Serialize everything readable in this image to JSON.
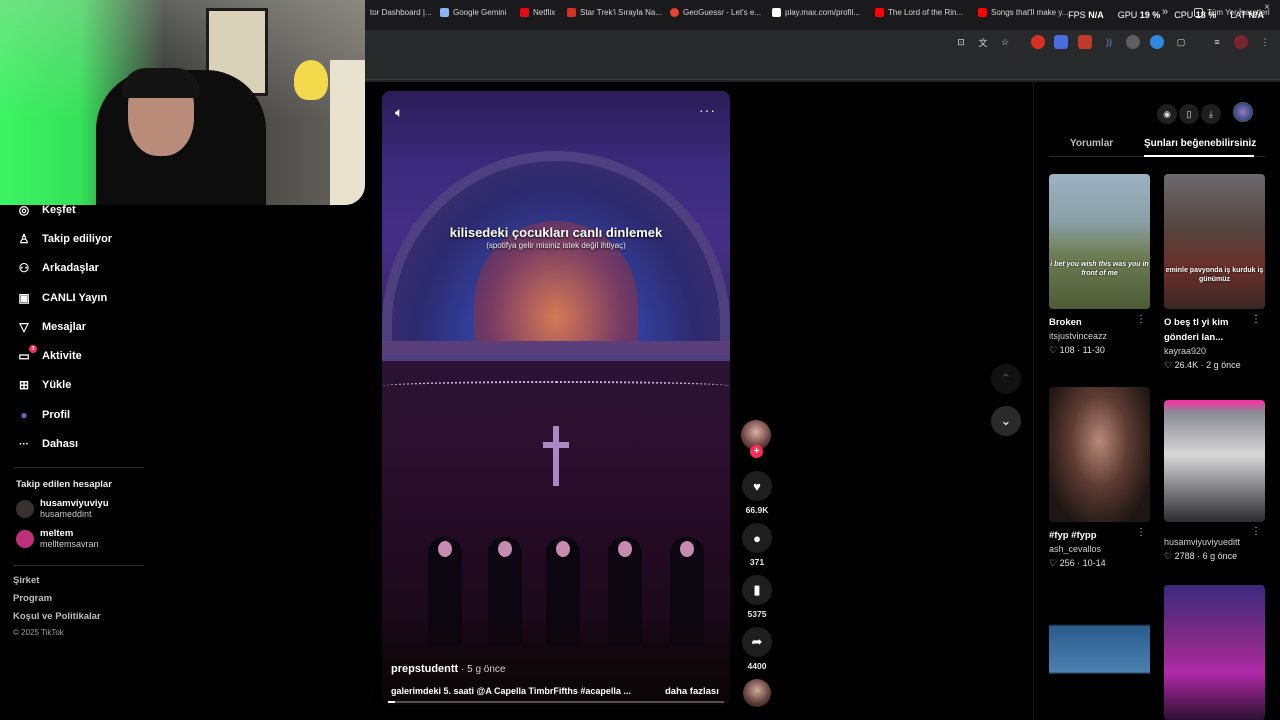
{
  "overlay": {
    "fps_label": "FPS",
    "fps_value": "N/A",
    "gpu_label": "GPU",
    "gpu_value": "19 %",
    "cpu_label": "CPU",
    "cpu_value": "18 %",
    "lat_label": "LAT",
    "lat_value": "N/A",
    "close": "×"
  },
  "bookmarks": [
    {
      "label": "tor Dashboard |...",
      "color": "#9aa0a6"
    },
    {
      "label": "Google Gemini",
      "color": "#8ab4f8"
    },
    {
      "label": "Netflix",
      "color": "#e50914"
    },
    {
      "label": "Star Trek'i Sırayla Na...",
      "color": "#d93025"
    },
    {
      "label": "GeoGuessr - Let's e...",
      "color": "#ea4335"
    },
    {
      "label": "play.max.com/profil...",
      "color": "#ffffff"
    },
    {
      "label": "The Lord of the Rin...",
      "color": "#ff0000"
    },
    {
      "label": "Songs that'll make y...",
      "color": "#ff0000"
    }
  ],
  "bookmarks_more": "»",
  "bookmarks_all": "Tüm Yer İşaretleri",
  "sidebar": {
    "items": [
      {
        "label": "Keşfet",
        "icon": "compass-icon",
        "glyph": "◎"
      },
      {
        "label": "Takip ediliyor",
        "icon": "following-icon",
        "glyph": "♙"
      },
      {
        "label": "Arkadaşlar",
        "icon": "friends-icon",
        "glyph": "⚇"
      },
      {
        "label": "CANLI Yayın",
        "icon": "live-tv-icon",
        "glyph": "▣"
      },
      {
        "label": "Mesajlar",
        "icon": "messages-icon",
        "glyph": "▽"
      },
      {
        "label": "Aktivite",
        "icon": "activity-icon",
        "glyph": "▭",
        "badge": "3"
      },
      {
        "label": "Yükle",
        "icon": "upload-icon",
        "glyph": "⊞"
      },
      {
        "label": "Profil",
        "icon": "profile-avatar-icon",
        "glyph": "●"
      },
      {
        "label": "Dahası",
        "icon": "more-dots-icon",
        "glyph": "···"
      }
    ],
    "following_title": "Takip edilen hesaplar",
    "following": [
      {
        "name": "husamviyuviyu",
        "handle": "husameddint",
        "color": "#3b3030"
      },
      {
        "name": "meltem",
        "handle": "melltemsavran",
        "color": "#c0307a"
      }
    ],
    "footer": [
      "Şirket",
      "Program",
      "Koşul ve Politikalar"
    ],
    "copyright": "© 2025 TikTok"
  },
  "video": {
    "caption_title": "kilisedeki çocukları canlı dinlemek",
    "caption_sub": "(spotifya gelir misiniz istek değil ihtiyaç)",
    "author": "prepstudentt",
    "time": " · 5 g önce",
    "description": "galerimdeki 5. saati @A Capella TimbrFifths #acapella ...",
    "more_link": "daha fazlası",
    "progress": 0.02
  },
  "actions": {
    "follow_plus": "+",
    "like_count": "66.9K",
    "comment_count": "371",
    "bookmark_count": "5375",
    "share_count": "4400"
  },
  "right_panel": {
    "tab_comments": "Yorumlar",
    "tab_like": "Şunları beğenebilirsiniz",
    "cards": [
      {
        "title": "Broken",
        "user": "itsjustvinceazz",
        "stats": "♡ 108 · 11-30",
        "overlay": "i bet you wish this was you in front of me",
        "bg": "linear-gradient(180deg,#9cb3c4 0%,#8aa0a6 35%,#6f7d55 60%,#4e5b36 100%)"
      },
      {
        "title": "O beş tl yi kim gönderi lan...",
        "user": "kayraa920",
        "stats": "♡ 26.4K · 2 g önce",
        "overlay": "eminle pavyonda iş kurduk iş günümüz",
        "bg": "linear-gradient(180deg,#6b6a6e 0%,#54443f 40%,#6c2f2a 70%,#3a2624 100%)"
      },
      {
        "title": "#fyp #fypp",
        "user": "ash_cevallos",
        "stats": "♡ 256 · 10-14",
        "overlay": "",
        "bg": "radial-gradient(ellipse at 50% 40%,#b8897a 0%,#5e3b32 40%,#1d1614 80%)"
      },
      {
        "title": "",
        "user": "husamviyuviyueditt",
        "stats": "♡ 2788 · 6 g önce",
        "overlay": "",
        "bg": "linear-gradient(180deg,#ff2aa3 0%,#8a8a94 10%,#d8d8d8 45%,#2b2b30 100%)"
      },
      {
        "title": "",
        "user": "",
        "stats": "",
        "overlay": "",
        "bg": "linear-gradient(180deg,#000 0%,#000 30%,#2a5d8c 40%,#4b80b0 60%,#000 70%,#000 100%)"
      },
      {
        "title": "",
        "user": "",
        "stats": "",
        "overlay": "",
        "bg": "linear-gradient(180deg,#3a2a7c 0%,#8a2a8a 45%,#b02aa8 65%,#2a1030 100%)"
      }
    ]
  }
}
